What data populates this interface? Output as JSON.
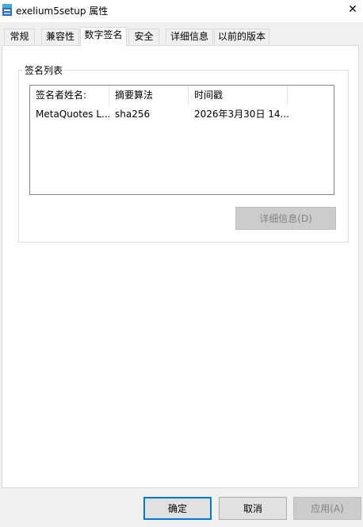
{
  "window": {
    "title": "exelium5setup 属性",
    "close_glyph": "✕"
  },
  "tabs": [
    {
      "label": "常规"
    },
    {
      "label": "兼容性"
    },
    {
      "label": "数字签名"
    },
    {
      "label": "安全"
    },
    {
      "label": "详细信息"
    },
    {
      "label": "以前的版本"
    }
  ],
  "active_tab": "数字签名",
  "signature_group": {
    "title": "签名列表",
    "columns": [
      "签名者姓名:",
      "摘要算法",
      "时间戳"
    ],
    "rows": [
      [
        "MetaQuotes L...",
        "sha256",
        "2026年3月30日 14..."
      ]
    ],
    "details_button": "详细信息(D)"
  },
  "footer": {
    "ok": "确定",
    "cancel": "取消",
    "apply": "应用(A)"
  },
  "colors": {
    "focus_border": "#0078d7",
    "disabled_text": "#838383"
  },
  "icons": {
    "app": "installer-icon",
    "close": "close-icon"
  }
}
